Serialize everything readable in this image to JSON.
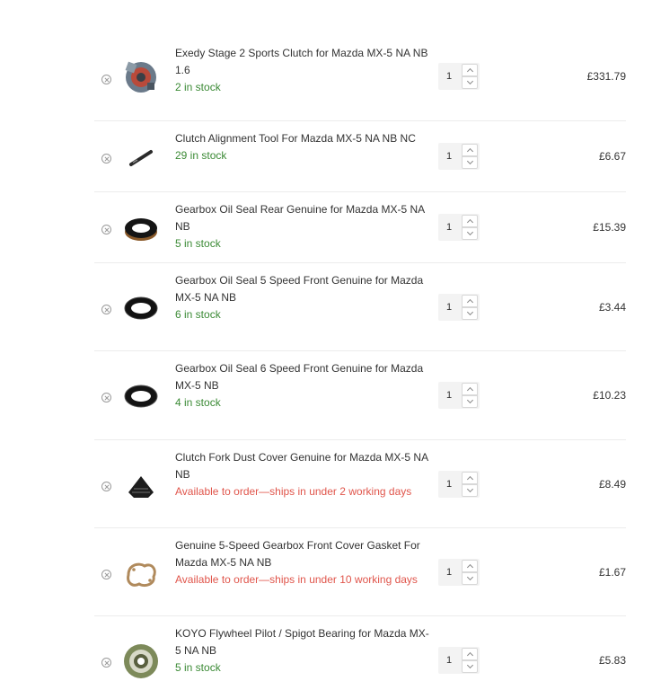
{
  "cart": {
    "items": [
      {
        "name": "Exedy Stage 2 Sports Clutch for Mazda MX-5 NA NB 1.6",
        "stock": "2 in stock",
        "stock_status": "in-stock",
        "quantity": "1",
        "price": "£331.79",
        "image": "clutch-kit-image"
      },
      {
        "name": "Clutch Alignment Tool For Mazda MX-5 NA NB NC",
        "stock": "29 in stock",
        "stock_status": "in-stock",
        "quantity": "1",
        "price": "£6.67",
        "image": "alignment-tool-image"
      },
      {
        "name": "Gearbox Oil Seal Rear Genuine for Mazda MX-5 NA NB",
        "stock": "5 in stock",
        "stock_status": "in-stock",
        "quantity": "1",
        "price": "£15.39",
        "image": "oil-seal-image"
      },
      {
        "name": "Gearbox Oil Seal 5 Speed Front Genuine for Mazda MX-5 NA NB",
        "stock": "6 in stock",
        "stock_status": "in-stock",
        "quantity": "1",
        "price": "£3.44",
        "image": "oil-seal-image"
      },
      {
        "name": "Gearbox Oil Seal 6 Speed Front Genuine for Mazda MX-5 NB",
        "stock": "4 in stock",
        "stock_status": "in-stock",
        "quantity": "1",
        "price": "£10.23",
        "image": "oil-seal-image"
      },
      {
        "name": "Clutch Fork Dust Cover Genuine for Mazda MX-5 NA NB",
        "stock": "Available to order—ships in under 2 working days",
        "stock_status": "backorder",
        "quantity": "1",
        "price": "£8.49",
        "image": "dust-cover-image"
      },
      {
        "name": "Genuine 5-Speed Gearbox Front Cover Gasket For Mazda MX-5 NA NB",
        "stock": "Available to order—ships in under 10 working days",
        "stock_status": "backorder",
        "quantity": "1",
        "price": "£1.67",
        "image": "gasket-image"
      },
      {
        "name": "KOYO Flywheel Pilot / Spigot Bearing for Mazda MX-5 NA NB",
        "stock": "5 in stock",
        "stock_status": "in-stock",
        "quantity": "1",
        "price": "£5.83",
        "image": "bearing-image"
      }
    ]
  },
  "colors": {
    "in_stock": "#3b8a35",
    "backorder": "#e0554b",
    "divider": "#ececec"
  }
}
